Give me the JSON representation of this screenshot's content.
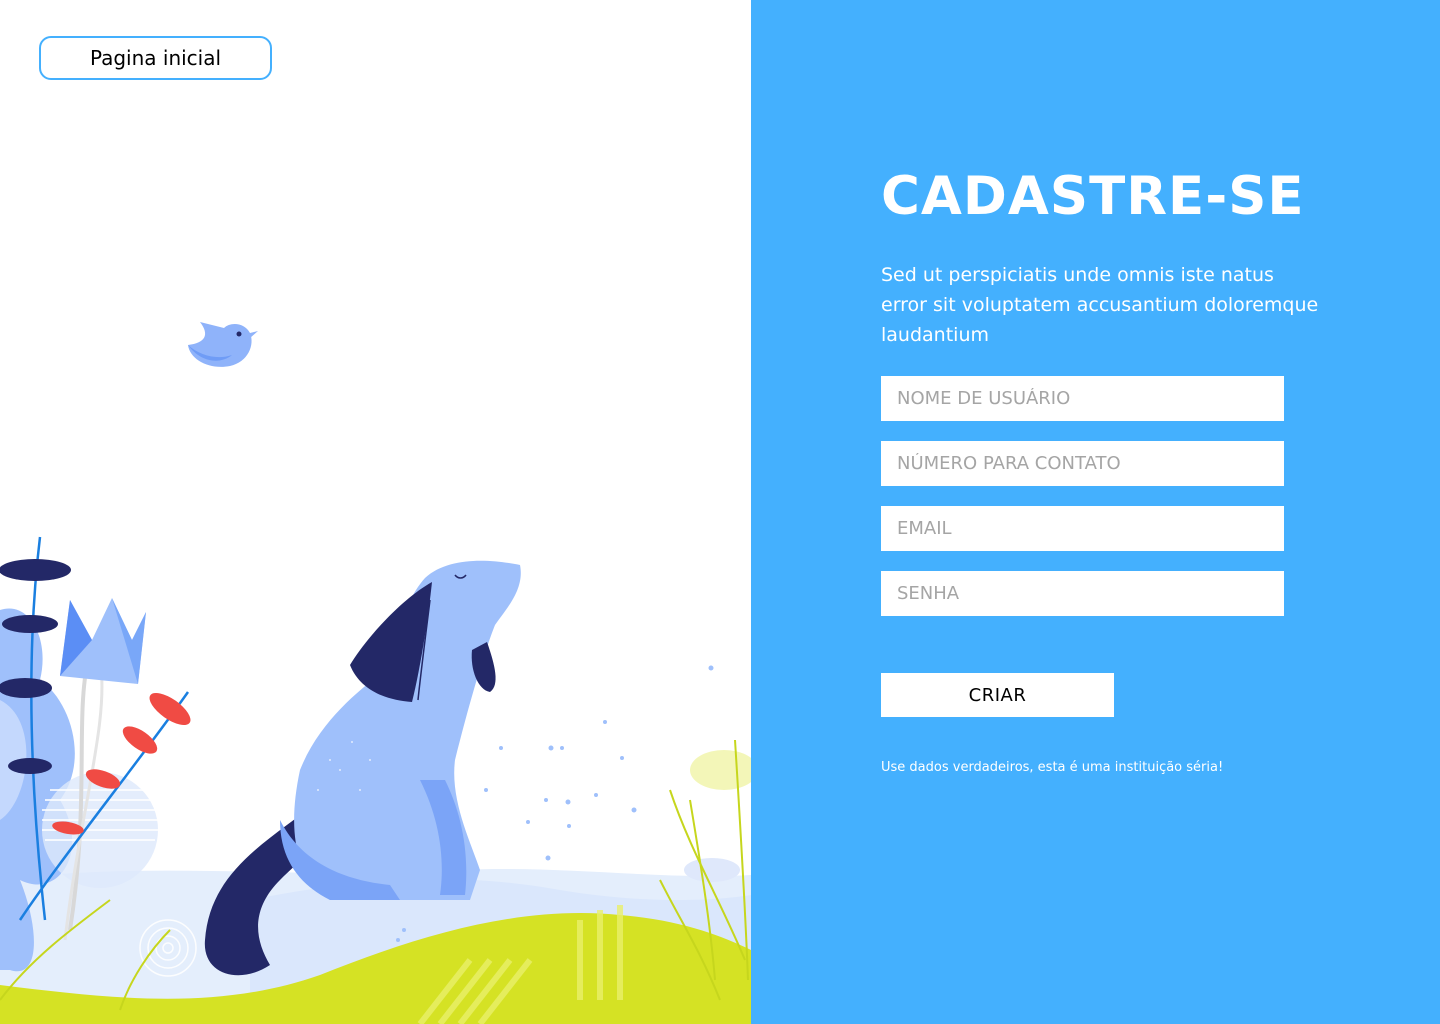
{
  "nav": {
    "home_label": "Pagina inicial"
  },
  "signup": {
    "title": "CADASTRE-SE",
    "subtitle": "Sed ut perspiciatis unde omnis iste natus error sit voluptatem accusantium doloremque laudantium",
    "fields": {
      "username": {
        "placeholder": "NOME DE USUÁRIO"
      },
      "phone": {
        "placeholder": "NÚMERO PARA CONTATO"
      },
      "email": {
        "placeholder": "EMAIL"
      },
      "password": {
        "placeholder": "SENHA"
      }
    },
    "submit_label": "CRIAR",
    "notice": "Use dados verdadeiros, esta é uma instituição séria!"
  },
  "colors": {
    "accent": "#44b0fe",
    "dog": "#9fc0fb",
    "dog_ears": "#232867",
    "grass": "#d5e224",
    "petal_red": "#f04b44"
  }
}
